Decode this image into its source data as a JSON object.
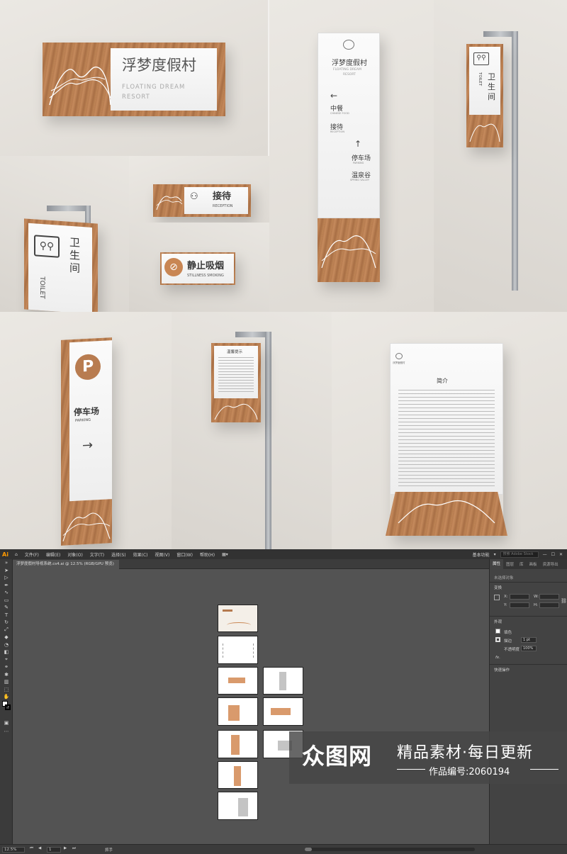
{
  "mockups": {
    "main_sign": {
      "name_cn": "浮梦度假村",
      "name_en_1": "FLOATING DREAM",
      "name_en_2": "RESORT"
    },
    "toilet_left": {
      "label_cn": "卫生间",
      "label_en": "TOILET"
    },
    "reception": {
      "label_cn": "接待",
      "label_en": "RECEPTION"
    },
    "no_smoking": {
      "label_cn": "静止吸烟",
      "label_en": "STILLNESS SMOKING"
    },
    "directory": {
      "brand_cn": "浮梦度假村",
      "brand_en_1": "FLOATING DREAM",
      "brand_en_2": "RESORT",
      "items": [
        {
          "arrow": "←",
          "cn": "中餐",
          "en": "CHINESE FOOD"
        },
        {
          "arrow": "",
          "cn": "接待",
          "en": "RECEPTION"
        },
        {
          "arrow": "↑",
          "cn": "停车场",
          "en": "PARKING"
        },
        {
          "arrow": "",
          "cn": "温泉谷",
          "en": "SPRING VALLEY"
        }
      ]
    },
    "toilet_right": {
      "label_cn": "卫生间",
      "label_en": "TOILET"
    },
    "parking": {
      "icon": "P",
      "label_cn": "停车场",
      "label_en": "PARKING",
      "arrow": "→"
    },
    "notice": {
      "title": "温馨提示"
    },
    "intro": {
      "title": "简介",
      "brand": "浮梦度假村"
    }
  },
  "illustrator": {
    "app_logo": "Ai",
    "menus": [
      "文件(F)",
      "编辑(E)",
      "对象(O)",
      "文字(T)",
      "选择(S)",
      "效果(C)",
      "视图(V)",
      "窗口(W)",
      "帮助(H)"
    ],
    "workspace": "基本功能",
    "search_placeholder": "搜索 Adobe Stock",
    "document_tab": "浮梦度假村导视系统.cs4.ai @ 12.5% (RGB/GPU 预览)",
    "panel": {
      "tabs": [
        "属性",
        "图层",
        "库",
        "画板",
        "资源导出"
      ],
      "no_selection": "未选择对象",
      "transform_label": "变换",
      "x_label": "X:",
      "y_label": "Y:",
      "w_label": "W:",
      "h_label": "H:",
      "appearance_label": "外观",
      "fill_label": "填色",
      "stroke_label": "描边",
      "stroke_value": "1 pt",
      "opacity_label": "不透明度",
      "opacity_value": "100%",
      "fx_label": "fx.",
      "quick_actions": "快速操作"
    },
    "status": {
      "zoom": "12.5%",
      "page": "1",
      "tool": "抓手"
    }
  },
  "watermark": {
    "logo": "众图网",
    "tagline": "精品素材·每日更新",
    "code": "作品编号:2060194"
  },
  "colors": {
    "wood": "#b57a4e",
    "accent_orange": "#ff9a00",
    "ui_dark": "#323232",
    "canvas_gray": "#535353"
  }
}
